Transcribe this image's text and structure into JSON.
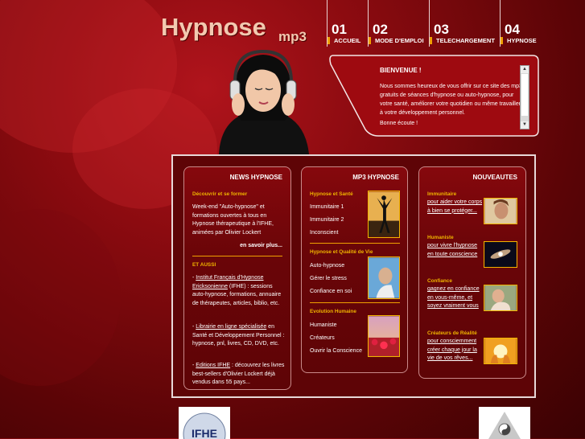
{
  "logo": {
    "title": "Hypnose",
    "subtitle": "mp3"
  },
  "nav": [
    {
      "num": "01",
      "label": "ACCUEIL"
    },
    {
      "num": "02",
      "label": "MODE D'EMPLOI"
    },
    {
      "num": "03",
      "label": "TELECHARGEMENT"
    },
    {
      "num": "04",
      "label": "HYPNOSE"
    }
  ],
  "welcome": {
    "title": "BIENVENUE !",
    "text": "Nous sommes heureux de vous offrir sur ce site des mp3 gratuits de séances d'hypnose ou auto-hypnose, pour votre santé, améliorer votre quotidien ou même travailler à votre développement personnel.",
    "signoff": "Bonne écoute !"
  },
  "news": {
    "header": "NEWS HYPNOSE",
    "section1_title": "Découvrir et se former",
    "section1_text": "Week-end \"Auto-hypnose\" et formations ouvertes à tous en Hypnose thérapeutique à l'IFHE, animées par Olivier Lockert",
    "more_link": "en savoir plus...",
    "section2_title": "ET AUSSI",
    "item1_link": "Institut Français d'Hypnose Ericksonienne",
    "item1_prefix": "- ",
    "item1_text": " (IFHE) : sessions auto-hypnose, formations, annuaire de thérapeutes, articles, biblio, etc.",
    "item2_prefix": "- ",
    "item2_link": "Librairie en ligne spécialisée",
    "item2_text": " en Santé et Développement Personnel : hypnose, pnl, livres, CD, DVD, etc.",
    "item3_prefix": "- ",
    "item3_link": "Editions IFHE",
    "item3_text": " : découvrez les livres best-sellers d'Olivier Lockert déjà vendus dans 55 pays..."
  },
  "mp3": {
    "header": "MP3 HYPNOSE",
    "groups": [
      {
        "title": "Hypnose et Santé",
        "items": [
          "Immunitaire 1",
          "Immunitaire 2",
          "Inconscient"
        ]
      },
      {
        "title": "Hypnose et Qualité de Vie",
        "items": [
          "Auto-hypnose",
          "Gérer le stress",
          "Confiance en soi"
        ]
      },
      {
        "title": "Evolution Humaine",
        "items": [
          "Humaniste",
          "Créateurs",
          "Ouvrir la Conscience"
        ]
      }
    ]
  },
  "nouveautes": {
    "header": "NOUVEAUTES",
    "items": [
      {
        "title": "Immunitaire",
        "link": "pour aider votre corps à bien se protéger..."
      },
      {
        "title": "Humaniste",
        "link": "pour vivre l'hypnose en toute conscience"
      },
      {
        "title": "Confiance",
        "link": "gagnez en confiance en vous-même, et soyez vraiment vous"
      },
      {
        "title": "Créateurs de Réalité",
        "link": "pour consciemment créer chaque jour la vie de vos rêves..."
      }
    ]
  },
  "footer": {
    "ifhe_logo": "IFHE"
  },
  "colors": {
    "accent": "#f0b400",
    "background": "#8c0b10",
    "panel": "#5e0406"
  }
}
